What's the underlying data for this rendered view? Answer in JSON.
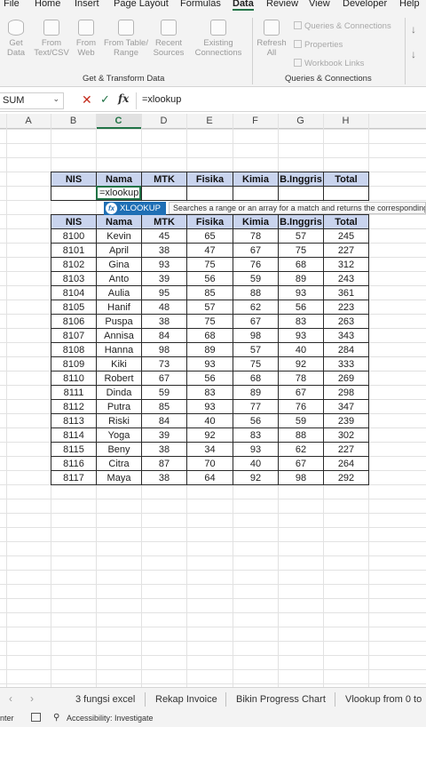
{
  "menu": [
    "File",
    "Home",
    "Insert",
    "Page Layout",
    "Formulas",
    "Data",
    "Review",
    "View",
    "Developer",
    "Help"
  ],
  "menu_active": "Data",
  "ribbon": {
    "get_data": "Get Data",
    "from_text_csv": "From Text/CSV",
    "from_web": "From Web",
    "from_table_range": "From Table/ Range",
    "recent_sources": "Recent Sources",
    "existing_connections": "Existing Connections",
    "group_get_transform": "Get & Transform Data",
    "refresh_all": "Refresh All",
    "queries_connections": "Queries & Connections",
    "properties": "Properties",
    "workbook_links": "Workbook Links",
    "group_queries": "Queries & Connections"
  },
  "formula_bar": {
    "name_box": "SUM",
    "fx": "fx",
    "formula": "=xlookup"
  },
  "columns": [
    "A",
    "B",
    "C",
    "D",
    "E",
    "F",
    "G",
    "H"
  ],
  "selected_column": "C",
  "header_row": [
    "NIS",
    "Nama",
    "MTK",
    "Fisika",
    "Kimia",
    "B.Inggris",
    "Total"
  ],
  "editing_cell_text": "=xlookup",
  "autocomplete": {
    "suggestion": "XLOOKUP",
    "tooltip": "Searches a range or an array for a match and returns the corresponding item"
  },
  "table_rows": [
    [
      "8100",
      "Kevin",
      "45",
      "65",
      "78",
      "57",
      "245"
    ],
    [
      "8101",
      "April",
      "38",
      "47",
      "67",
      "75",
      "227"
    ],
    [
      "8102",
      "Gina",
      "93",
      "75",
      "76",
      "68",
      "312"
    ],
    [
      "8103",
      "Anto",
      "39",
      "56",
      "59",
      "89",
      "243"
    ],
    [
      "8104",
      "Aulia",
      "95",
      "85",
      "88",
      "93",
      "361"
    ],
    [
      "8105",
      "Hanif",
      "48",
      "57",
      "62",
      "56",
      "223"
    ],
    [
      "8106",
      "Puspa",
      "38",
      "75",
      "67",
      "83",
      "263"
    ],
    [
      "8107",
      "Annisa",
      "84",
      "68",
      "98",
      "93",
      "343"
    ],
    [
      "8108",
      "Hanna",
      "98",
      "89",
      "57",
      "40",
      "284"
    ],
    [
      "8109",
      "Kiki",
      "73",
      "93",
      "75",
      "92",
      "333"
    ],
    [
      "8110",
      "Robert",
      "67",
      "56",
      "68",
      "78",
      "269"
    ],
    [
      "8111",
      "Dinda",
      "59",
      "83",
      "89",
      "67",
      "298"
    ],
    [
      "8112",
      "Putra",
      "85",
      "93",
      "77",
      "76",
      "347"
    ],
    [
      "8113",
      "Riski",
      "84",
      "40",
      "56",
      "59",
      "239"
    ],
    [
      "8114",
      "Yoga",
      "39",
      "92",
      "83",
      "88",
      "302"
    ],
    [
      "8115",
      "Beny",
      "38",
      "34",
      "93",
      "62",
      "227"
    ],
    [
      "8116",
      "Citra",
      "87",
      "70",
      "40",
      "67",
      "264"
    ],
    [
      "8117",
      "Maya",
      "38",
      "64",
      "92",
      "98",
      "292"
    ]
  ],
  "sheet_tabs": [
    "3 fungsi excel",
    "Rekap Invoice",
    "Bikin Progress Chart",
    "Vlookup from 0 to"
  ],
  "status": {
    "mode": "nter",
    "accessibility": "Accessibility: Investigate"
  },
  "colors": {
    "accent": "#217346",
    "header_fill": "#c9d4ee",
    "autocomplete": "#1f6fb5"
  }
}
